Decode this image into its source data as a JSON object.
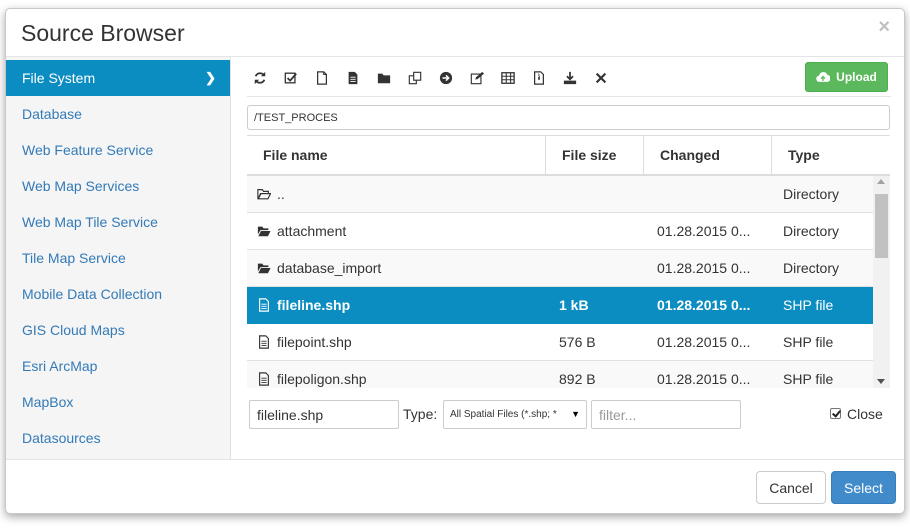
{
  "dialog": {
    "title": "Source Browser",
    "close_glyph": "×"
  },
  "sidebar": {
    "items": [
      {
        "label": "File System",
        "active": true
      },
      {
        "label": "Database"
      },
      {
        "label": "Web Feature Service"
      },
      {
        "label": "Web Map Services"
      },
      {
        "label": "Web Map Tile Service"
      },
      {
        "label": "Tile Map Service"
      },
      {
        "label": "Mobile Data Collection"
      },
      {
        "label": "GIS Cloud Maps"
      },
      {
        "label": "Esri ArcMap"
      },
      {
        "label": "MapBox"
      },
      {
        "label": "Datasources"
      }
    ],
    "chevron": "❯"
  },
  "toolbar": {
    "icons": [
      "refresh-icon",
      "check-square-icon",
      "new-file-icon",
      "file-text-icon",
      "folder-icon",
      "copy-icon",
      "arrow-circle-right-icon",
      "edit-icon",
      "table-icon",
      "zip-file-icon",
      "download-icon",
      "delete-icon"
    ],
    "upload_label": "Upload"
  },
  "path": {
    "value": "/TEST_PROCES"
  },
  "table": {
    "headers": {
      "name": "File name",
      "size": "File size",
      "changed": "Changed",
      "type": "Type"
    },
    "rows": [
      {
        "icon": "folder-open-icon",
        "name": "..",
        "size": "",
        "changed": "",
        "type": "Directory"
      },
      {
        "icon": "folder-icon",
        "name": "attachment",
        "size": "",
        "changed": "01.28.2015 0...",
        "type": "Directory"
      },
      {
        "icon": "folder-icon",
        "name": "database_import",
        "size": "",
        "changed": "01.28.2015 0...",
        "type": "Directory"
      },
      {
        "icon": "file-icon",
        "name": "fileline.shp",
        "size": "1 kB",
        "changed": "01.28.2015 0...",
        "type": "SHP file",
        "selected": true
      },
      {
        "icon": "file-icon",
        "name": "filepoint.shp",
        "size": "576 B",
        "changed": "01.28.2015 0...",
        "type": "SHP file"
      },
      {
        "icon": "file-icon",
        "name": "filepoligon.shp",
        "size": "892 B",
        "changed": "01.28.2015 0...",
        "type": "SHP file"
      }
    ]
  },
  "bottom": {
    "filename_value": "fileline.shp",
    "type_label": "Type:",
    "type_selected": "All Spatial Files (*.shp; *",
    "type_caret": "▼",
    "filter_placeholder": "filter...",
    "close_label": "Close",
    "close_checked": true
  },
  "footer": {
    "cancel_label": "Cancel",
    "select_label": "Select"
  },
  "colors": {
    "accent": "#0c8dc2",
    "upload": "#5cb85c",
    "select": "#428bca",
    "link": "#337ab7"
  }
}
